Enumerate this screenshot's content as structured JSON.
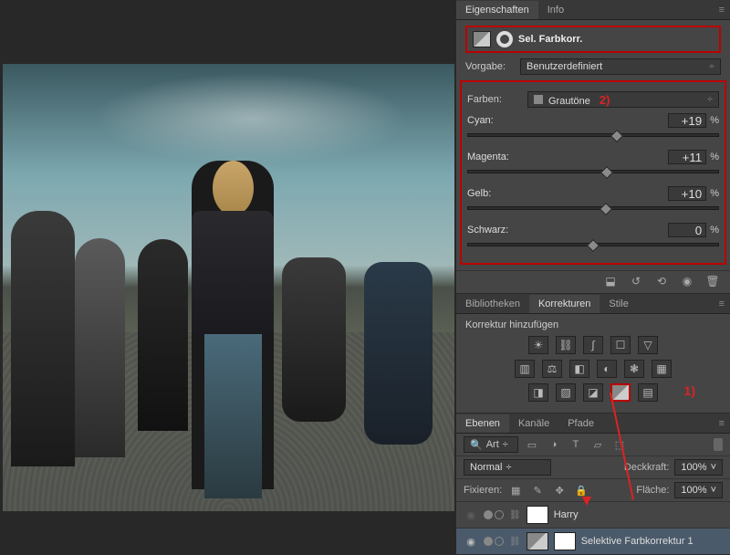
{
  "panels": {
    "properties": {
      "tab_properties": "Eigenschaften",
      "tab_info": "Info",
      "adj_title": "Sel. Farbkorr."
    },
    "adjustments": {
      "tab_lib": "Bibliotheken",
      "tab_adj": "Korrekturen",
      "tab_styles": "Stile",
      "add_label": "Korrektur hinzufügen"
    },
    "layers": {
      "tab_layers": "Ebenen",
      "tab_channels": "Kanäle",
      "tab_paths": "Pfade"
    }
  },
  "preset": {
    "label": "Vorgabe:",
    "value": "Benutzerdefiniert"
  },
  "colors_select": {
    "label": "Farben:",
    "value": "Grautöne"
  },
  "sliders": {
    "cyan": {
      "label": "Cyan:",
      "value": "+19",
      "pos": 59.5
    },
    "magenta": {
      "label": "Magenta:",
      "value": "+11",
      "pos": 55.5
    },
    "yellow": {
      "label": "Gelb:",
      "value": "+10",
      "pos": 55
    },
    "black": {
      "label": "Schwarz:",
      "value": "0",
      "pos": 50
    }
  },
  "percent": "%",
  "annotations": {
    "one": "1)",
    "two": "2)"
  },
  "layers_panel": {
    "filter_kind": "Art",
    "blend_mode": "Normal",
    "opacity_lbl": "Deckkraft:",
    "opacity_val": "100%",
    "lock_lbl": "Fixieren:",
    "fill_lbl": "Fläche:",
    "fill_val": "100%",
    "items": [
      {
        "name": "Harry"
      },
      {
        "name": "Selektive Farbkorrektur 1"
      }
    ]
  },
  "icons": {
    "brightness": "☀",
    "levels": "⛓",
    "curves": "∫",
    "exposure": "☐",
    "tri": "▽",
    "vibrance": "▥",
    "hue": "⚖",
    "colorbal": "◧",
    "bw": "◐",
    "photo": "❃",
    "lookup": "▦",
    "invert": "◨",
    "poster": "▨",
    "thresh": "◪",
    "selcolor": "◩",
    "gradmap": "▤",
    "clip": "⬓",
    "reset": "↺",
    "eye": "◉",
    "trash": "🗑",
    "menu": "≡",
    "filter": "🔍",
    "img": "▭",
    "adj": "◑",
    "text": "T",
    "shape": "▱",
    "smart": "⬚",
    "transparency": "▦",
    "brush": "✎",
    "move": "✥",
    "lock": "🔒",
    "chev": "÷"
  }
}
